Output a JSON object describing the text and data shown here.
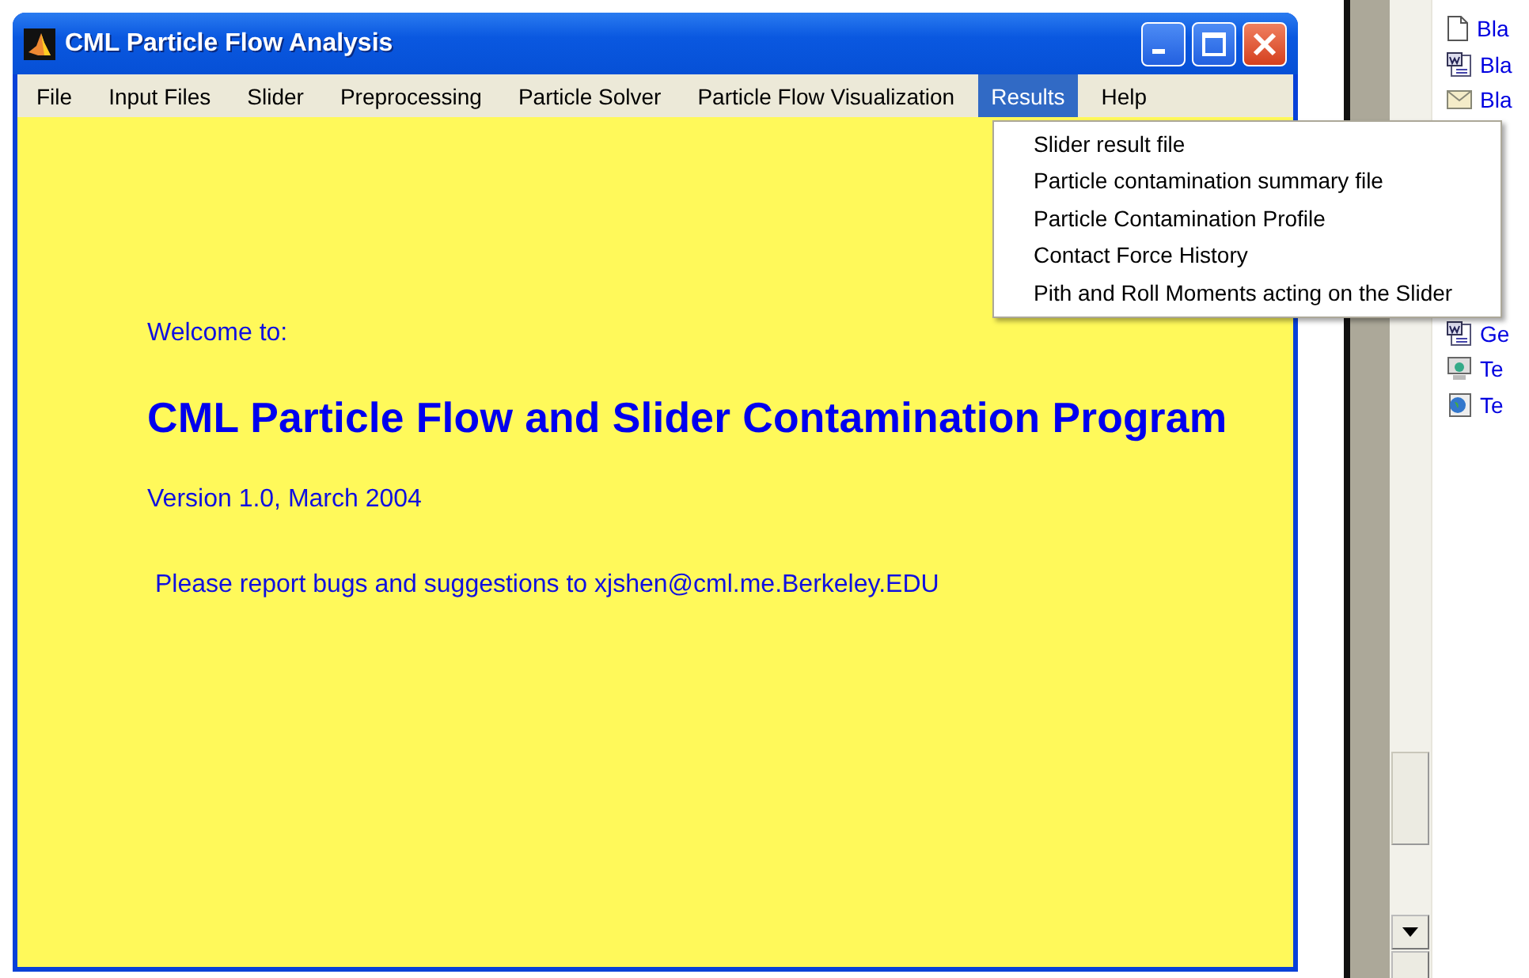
{
  "window": {
    "title": "CML Particle Flow Analysis"
  },
  "menu_bar": [
    {
      "label": "File",
      "selected": false
    },
    {
      "label": "Input Files",
      "selected": false
    },
    {
      "label": "Slider",
      "selected": false
    },
    {
      "label": "Preprocessing",
      "selected": false
    },
    {
      "label": "Particle Solver",
      "selected": false
    },
    {
      "label": "Particle Flow Visualization",
      "selected": false
    },
    {
      "label": "Results",
      "selected": true
    },
    {
      "label": "Help",
      "selected": false
    }
  ],
  "dropdown": [
    "Slider result file",
    "Particle contamination summary file",
    "Particle Contamination Profile",
    "Contact Force History",
    "Pith and Roll Moments acting on the Slider"
  ],
  "content": {
    "welcome": "Welcome to:",
    "heading": "CML Particle Flow and Slider Contamination Program",
    "version": "Version 1.0, March 2004",
    "contact": "Please report bugs and suggestions to xjshen@cml.me.Berkeley.EDU"
  },
  "background_window": {
    "top_items": [
      {
        "label": "Bla",
        "kind": "document"
      },
      {
        "label": "Bla",
        "kind": "word"
      },
      {
        "label": "Bla",
        "kind": "mail"
      }
    ],
    "bottom_items": [
      {
        "label": "Ge",
        "kind": "word"
      },
      {
        "label": "Te",
        "kind": "network"
      },
      {
        "label": "Te",
        "kind": "globe"
      }
    ]
  }
}
